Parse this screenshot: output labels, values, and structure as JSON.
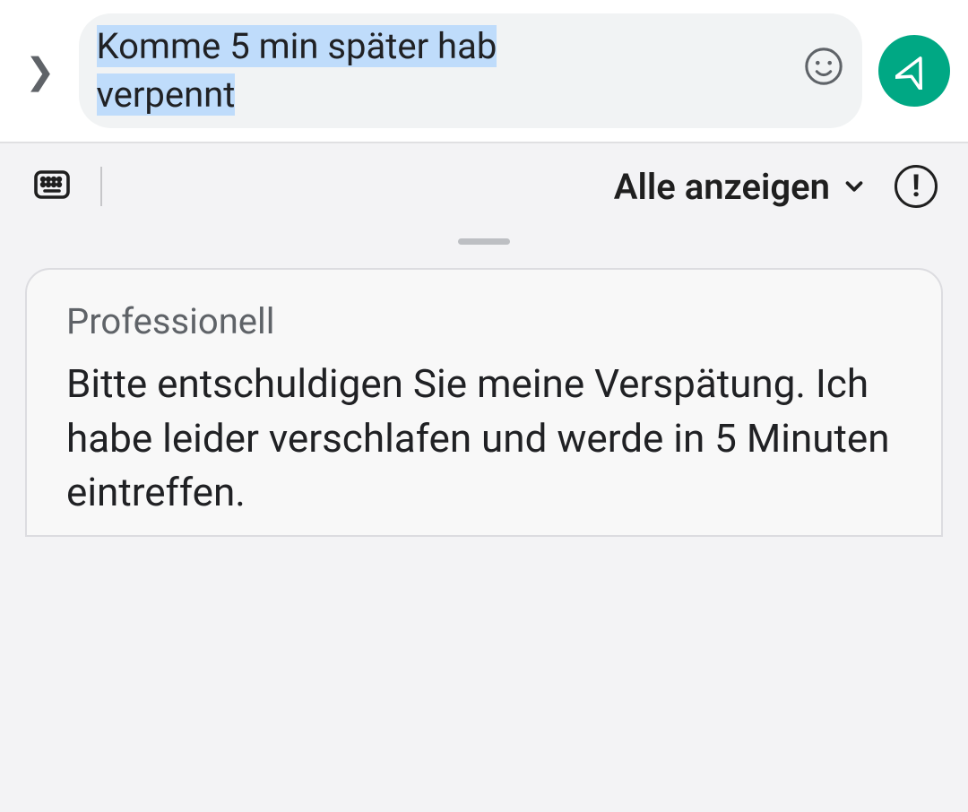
{
  "compose": {
    "text_line1": "Komme 5 min später hab",
    "text_line2": "verpennt"
  },
  "toolbar": {
    "show_all_label": "Alle anzeigen"
  },
  "suggestion": {
    "title": "Professionell",
    "body": "Bitte entschuldigen Sie meine Verspätung. Ich habe leider verschlafen und werde in 5 Minuten eintreffen."
  }
}
